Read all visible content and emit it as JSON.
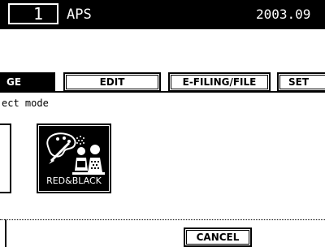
{
  "header": {
    "copy_count": "1",
    "paper_mode": "APS",
    "date": "2003.09"
  },
  "tabs": [
    {
      "label": "GE",
      "state": "selected"
    },
    {
      "label": "EDIT",
      "state": "normal"
    },
    {
      "label": "E-FILING/FILE",
      "state": "normal"
    },
    {
      "label": "SET",
      "state": "normal"
    }
  ],
  "instruction": "ect mode",
  "modes": {
    "red_black_label": "RED&BLACK"
  },
  "footer": {
    "cancel_label": "CANCEL"
  },
  "colors": {
    "background": "#ffffff",
    "foreground": "#000000"
  }
}
